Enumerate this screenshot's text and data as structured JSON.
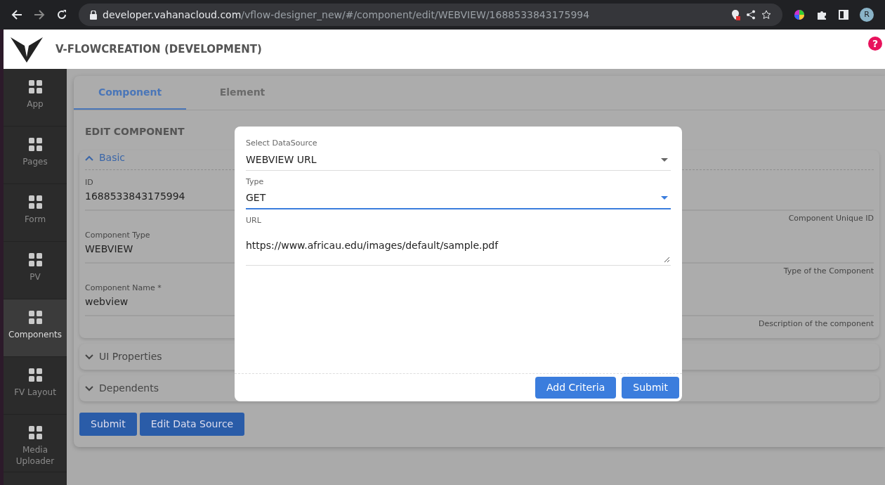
{
  "browser": {
    "url_host": "developer.vahanacloud.com",
    "url_path": "/vflow-designer_new/#/component/edit/WEBVIEW/1688533843175994",
    "avatar": "R"
  },
  "header": {
    "title": "V-FLOWCREATION (DEVELOPMENT)",
    "help": "?"
  },
  "sidebar": {
    "items": [
      {
        "label": "App",
        "selected": false
      },
      {
        "label": "Pages",
        "selected": false
      },
      {
        "label": "Form",
        "selected": false
      },
      {
        "label": "PV",
        "selected": false
      },
      {
        "label": "Components",
        "selected": true
      },
      {
        "label": "FV Layout",
        "selected": false
      },
      {
        "label": "Media Uploader",
        "selected": false
      }
    ]
  },
  "tabs": [
    {
      "label": "Component",
      "selected": true
    },
    {
      "label": "Element",
      "selected": false
    }
  ],
  "section_title": "EDIT COMPONENT",
  "sections": [
    {
      "title": "Basic",
      "expanded": true,
      "fields": [
        {
          "label": "ID",
          "value": "1688533843175994",
          "hint": "Component Unique ID"
        },
        {
          "label": "Component Type",
          "value": "WEBVIEW",
          "hint": "Type of the Component"
        },
        {
          "label": "Component Name *",
          "value": "webview",
          "hint": "Description of the component"
        }
      ]
    },
    {
      "title": "UI Properties",
      "expanded": false
    },
    {
      "title": "Dependents",
      "expanded": false
    }
  ],
  "buttons": [
    "Submit",
    "Edit Data Source"
  ],
  "modal": {
    "fields": [
      {
        "kind": "select",
        "label": "Select DataSource",
        "value": "WEBVIEW URL",
        "focused": false
      },
      {
        "kind": "select",
        "label": "Type",
        "value": "GET",
        "focused": true
      },
      {
        "kind": "textarea",
        "label": "URL",
        "value": "https://www.africau.edu/images/default/sample.pdf",
        "focused": false
      }
    ],
    "buttons": [
      "Add Criteria",
      "Submit"
    ]
  }
}
